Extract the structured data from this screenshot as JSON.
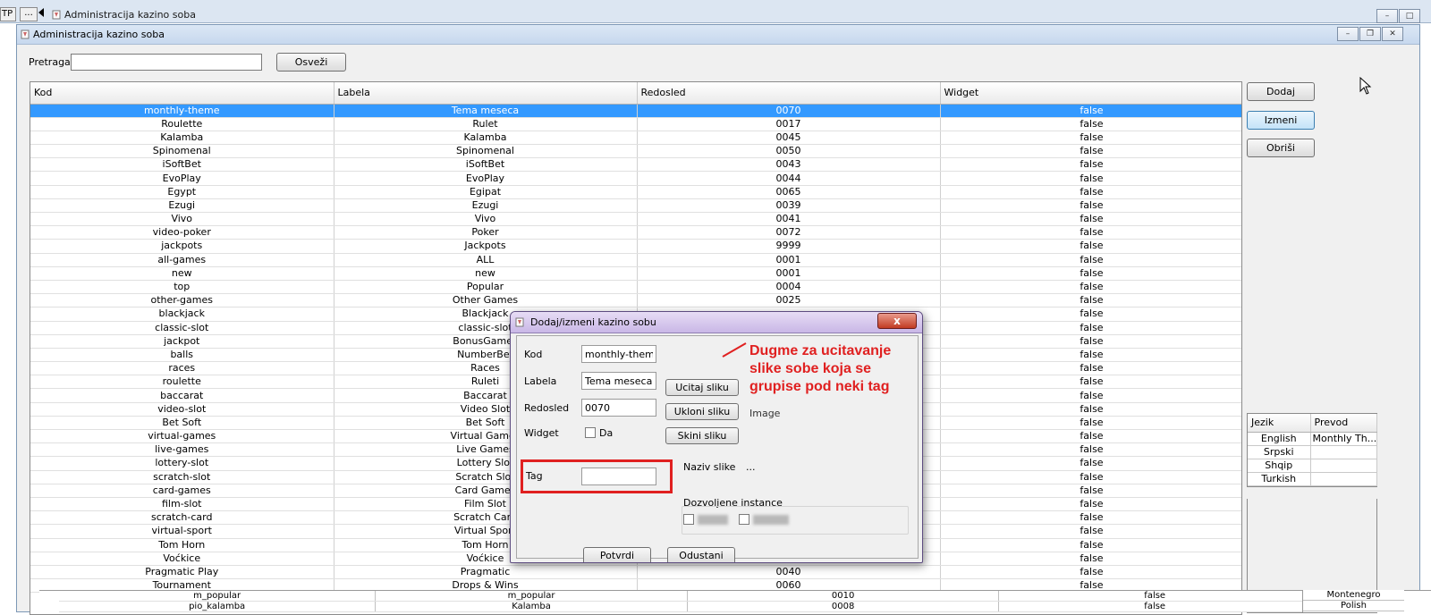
{
  "background_window": {
    "tp_button": "TP",
    "dots_button": "...",
    "title": "Administracija kazino soba"
  },
  "window": {
    "title": "Administracija kazino soba"
  },
  "search": {
    "label": "Pretraga",
    "value": "",
    "refresh_label": "Osveži"
  },
  "actions": {
    "add": "Dodaj",
    "edit": "Izmeni",
    "delete": "Obriši"
  },
  "table": {
    "columns": [
      "Kod",
      "Labela",
      "Redosled",
      "Widget"
    ],
    "rows": [
      [
        "monthly-theme",
        "Tema meseca",
        "0070",
        "false"
      ],
      [
        "Roulette",
        "Rulet",
        "0017",
        "false"
      ],
      [
        "Kalamba",
        "Kalamba",
        "0045",
        "false"
      ],
      [
        "Spinomenal",
        "Spinomenal",
        "0050",
        "false"
      ],
      [
        "iSoftBet",
        "iSoftBet",
        "0043",
        "false"
      ],
      [
        "EvoPlay",
        "EvoPlay",
        "0044",
        "false"
      ],
      [
        "Egypt",
        "Egipat",
        "0065",
        "false"
      ],
      [
        "Ezugi",
        "Ezugi",
        "0039",
        "false"
      ],
      [
        "Vivo",
        "Vivo",
        "0041",
        "false"
      ],
      [
        "video-poker",
        "Poker",
        "0072",
        "false"
      ],
      [
        "jackpots",
        "Jackpots",
        "9999",
        "false"
      ],
      [
        "all-games",
        "ALL",
        "0001",
        "false"
      ],
      [
        "new",
        "new",
        "0001",
        "false"
      ],
      [
        "top",
        "Popular",
        "0004",
        "false"
      ],
      [
        "other-games",
        "Other Games",
        "0025",
        "false"
      ],
      [
        "blackjack",
        "Blackjack",
        "",
        "false"
      ],
      [
        "classic-slot",
        "classic-slot",
        "",
        "false"
      ],
      [
        "jackpot",
        "BonusGames",
        "",
        "false"
      ],
      [
        "balls",
        "NumberBet",
        "",
        "false"
      ],
      [
        "races",
        "Races",
        "",
        "false"
      ],
      [
        "roulette",
        "Ruleti",
        "",
        "false"
      ],
      [
        "baccarat",
        "Baccarat",
        "",
        "false"
      ],
      [
        "video-slot",
        "Video Slot",
        "",
        "false"
      ],
      [
        "Bet Soft",
        "Bet Soft",
        "",
        "false"
      ],
      [
        "virtual-games",
        "Virtual Games",
        "",
        "false"
      ],
      [
        "live-games",
        "Live Games",
        "",
        "false"
      ],
      [
        "lottery-slot",
        "Lottery Slot",
        "",
        "false"
      ],
      [
        "scratch-slot",
        "Scratch Slot",
        "",
        "false"
      ],
      [
        "card-games",
        "Card Games",
        "",
        "false"
      ],
      [
        "film-slot",
        "Film Slot",
        "",
        "false"
      ],
      [
        "scratch-card",
        "Scratch Card",
        "",
        "false"
      ],
      [
        "virtual-sport",
        "Virtual Sport",
        "",
        "false"
      ],
      [
        "Tom Horn",
        "Tom Horn",
        "",
        "false"
      ],
      [
        "Voćkice",
        "Voćkice",
        "",
        "false"
      ],
      [
        "Pragmatic Play",
        "Pragmatic",
        "0040",
        "false"
      ],
      [
        "Tournament",
        "Drops & Wins",
        "0060",
        "false"
      ]
    ]
  },
  "bottom_rows": [
    [
      "m_popular",
      "m_popular",
      "0010",
      "false"
    ],
    [
      "pio_kalamba",
      "Kalamba",
      "0008",
      "false"
    ]
  ],
  "languages": {
    "columns": [
      "Jezik",
      "Prevod"
    ],
    "rows": [
      [
        "English",
        "Monthly Th..."
      ],
      [
        "Srpski",
        ""
      ],
      [
        "Shqip",
        ""
      ],
      [
        "Turkish",
        ""
      ]
    ],
    "bottom_items": [
      "Montenegro",
      "Polish"
    ]
  },
  "dialog": {
    "title": "Dodaj/izmeni kazino sobu",
    "close": "x",
    "kod_label": "Kod",
    "kod_value": "monthly-theme",
    "labela_label": "Labela",
    "labela_value": "Tema meseca",
    "redosled_label": "Redosled",
    "redosled_value": "0070",
    "widget_label": "Widget",
    "widget_checkbox_label": "Da",
    "tag_label": "Tag",
    "tag_value": "",
    "upload_btn": "Ucitaj sliku",
    "remove_btn": "Ukloni sliku",
    "download_btn": "Skini sliku",
    "image_placeholder": "Image",
    "image_name_label": "Naziv slike",
    "image_name_value": "...",
    "instances_label": "Dozvoljene instance",
    "confirm_btn": "Potvrdi",
    "cancel_btn": "Odustani"
  },
  "annotation": {
    "text": "Dugme za ucitavanje slike sobe koja se grupise pod neki tag",
    "color": "#e02020"
  },
  "colors": {
    "selection": "#3399ff",
    "highlight": "#e02020"
  }
}
